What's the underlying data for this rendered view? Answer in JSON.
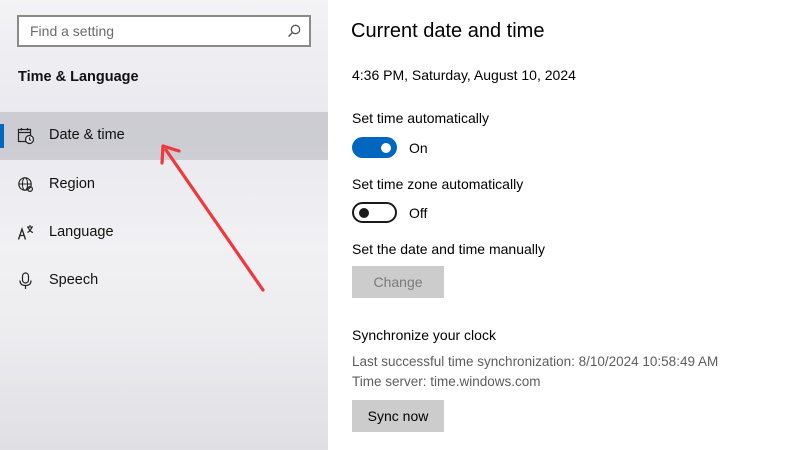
{
  "sidebar": {
    "search_placeholder": "Find a setting",
    "section_title": "Time & Language",
    "items": [
      {
        "label": "Date & time",
        "icon": "calendar-clock-icon",
        "selected": true
      },
      {
        "label": "Region",
        "icon": "globe-icon",
        "selected": false
      },
      {
        "label": "Language",
        "icon": "language-icon",
        "selected": false
      },
      {
        "label": "Speech",
        "icon": "microphone-icon",
        "selected": false
      }
    ]
  },
  "main": {
    "title": "Current date and time",
    "current_datetime": "4:36 PM, Saturday, August 10, 2024",
    "set_time_auto": {
      "label": "Set time automatically",
      "state": "On"
    },
    "set_timezone_auto": {
      "label": "Set time zone automatically",
      "state": "Off"
    },
    "manual": {
      "label": "Set the date and time manually",
      "button": "Change"
    },
    "sync": {
      "heading": "Synchronize your clock",
      "last_sync": "Last successful time synchronization: 8/10/2024 10:58:49 AM",
      "time_server": "Time server: time.windows.com",
      "button": "Sync now"
    }
  },
  "colors": {
    "accent": "#0067c0",
    "annotation_arrow": "#f0373c"
  }
}
